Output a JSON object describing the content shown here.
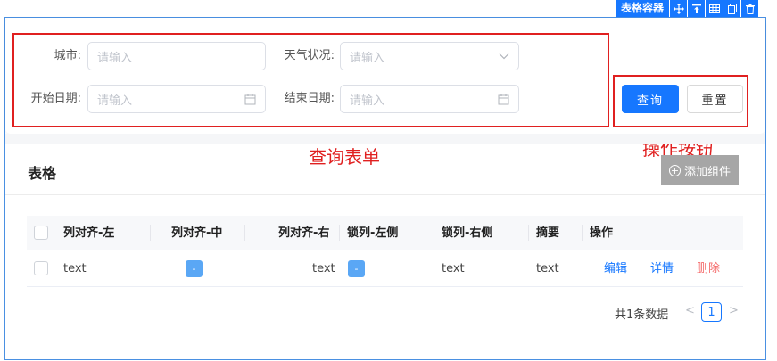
{
  "container": {
    "title": "表格容器",
    "tools": [
      "move-icon",
      "align-top-icon",
      "table-grid-icon",
      "copy-icon",
      "delete-icon"
    ]
  },
  "form": {
    "fields": [
      {
        "label": "城市:",
        "placeholder": "请输入",
        "suffix": ""
      },
      {
        "label": "天气状况:",
        "placeholder": "请输入",
        "suffix": "chevron-down-icon"
      },
      {
        "label": "开始日期:",
        "placeholder": "请输入",
        "suffix": "calendar-icon"
      },
      {
        "label": "结束日期:",
        "placeholder": "请输入",
        "suffix": "calendar-icon"
      }
    ],
    "buttons": {
      "query": "查询",
      "reset": "重置"
    }
  },
  "annotations": {
    "query_form": "查询表单",
    "action_buttons": "操作按钮",
    "color": "#e02020"
  },
  "table": {
    "title": "表格",
    "add_component": "添加组件",
    "columns": [
      "列对齐-左",
      "列对齐-中",
      "列对齐-右",
      "锁列-左侧",
      "锁列-右侧",
      "摘要",
      "操作"
    ],
    "rows": [
      {
        "left": "text",
        "center_tag": "-",
        "right": "text",
        "lock_left_tag": "-",
        "lock_right": "text",
        "summary": "text",
        "actions": [
          "编辑",
          "详情",
          "删除"
        ]
      }
    ]
  },
  "pagination": {
    "total": "共1条数据",
    "current": "1",
    "prev": "<",
    "next": ">"
  },
  "colors": {
    "primary": "#1677ff",
    "danger": "#f56c6c",
    "annotation": "#e02020"
  }
}
